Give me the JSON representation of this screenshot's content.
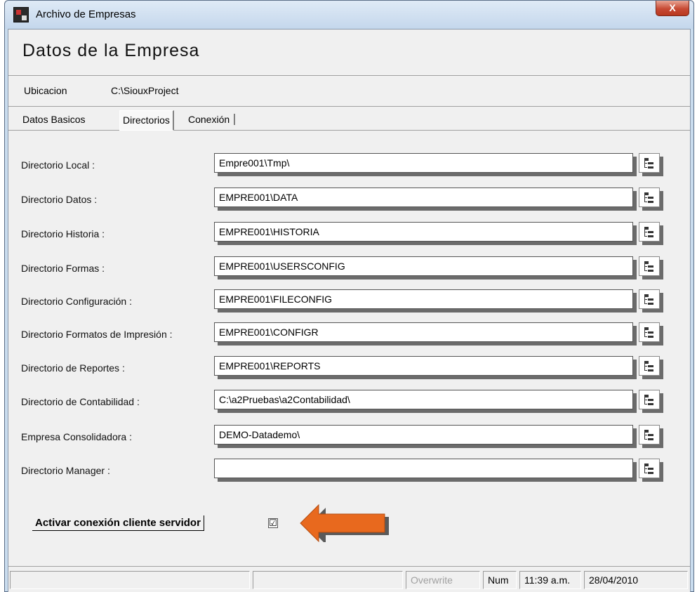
{
  "window": {
    "title": "Archivo de Empresas",
    "close_label": "X"
  },
  "header": {
    "title": "Datos de la Empresa"
  },
  "location": {
    "label": "Ubicacion",
    "value": "C:\\SiouxProject"
  },
  "tabs": [
    {
      "label": "Datos Basicos"
    },
    {
      "label": "Directorios"
    },
    {
      "label": "Conexión"
    }
  ],
  "fields": [
    {
      "label": "Directorio Local :",
      "value": "Empre001\\Tmp\\"
    },
    {
      "label": "Directorio Datos :",
      "value": "EMPRE001\\DATA"
    },
    {
      "label": "Directorio Historia :",
      "value": "EMPRE001\\HISTORIA"
    },
    {
      "label": "Directorio Formas :",
      "value": "EMPRE001\\USERSCONFIG"
    },
    {
      "label": "Directorio Configuración :",
      "value": "EMPRE001\\FILECONFIG"
    },
    {
      "label": "Directorio Formatos de Impresión :",
      "value": "EMPRE001\\CONFIGR"
    },
    {
      "label": "Directorio de Reportes :",
      "value": "EMPRE001\\REPORTS"
    },
    {
      "label": "Directorio de Contabilidad :",
      "value": "C:\\a2Pruebas\\a2Contabilidad\\"
    },
    {
      "label": "Empresa Consolidadora :",
      "value": "DEMO-Datademo\\"
    },
    {
      "label": "Directorio Manager :",
      "value": ""
    }
  ],
  "client_server": {
    "label": "Activar conexión cliente servidor",
    "checked": true,
    "check_glyph": "☑"
  },
  "statusbar": {
    "overwrite": "Overwrite",
    "num": "Num",
    "time": "11:39 a.m.",
    "date": "28/04/2010"
  },
  "colors": {
    "arrow": "#e8691e",
    "title_bg": "#c4d7ec",
    "client_bg": "#f0f0f0"
  }
}
